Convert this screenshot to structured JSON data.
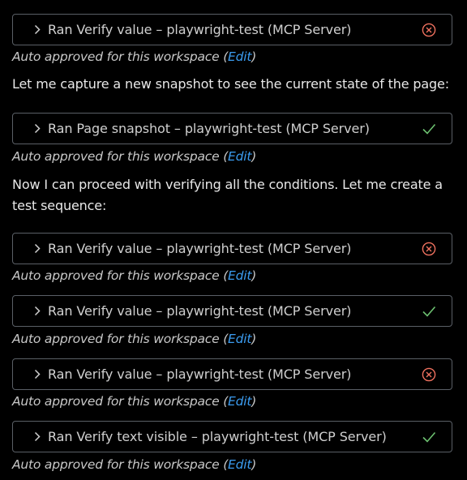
{
  "colors": {
    "background": "#000000",
    "card_border": "#5a5f66",
    "error": "#f0715f",
    "success": "#6cc070",
    "link": "#3b9cf0"
  },
  "items": [
    {
      "type": "tool",
      "ran_prefix": "Ran",
      "tool_name": "Verify value",
      "dash": "–",
      "server": "playwright-test (MCP Server)",
      "status": "error",
      "status_icon": "error-circle-x-icon",
      "approval_text": "Auto approved for this workspace",
      "approval_open": "(",
      "edit_label": "Edit",
      "approval_close": ")"
    },
    {
      "type": "message",
      "text": "Let me capture a new snapshot to see the current state of the page:"
    },
    {
      "type": "tool",
      "ran_prefix": "Ran",
      "tool_name": "Page snapshot",
      "dash": "–",
      "server": "playwright-test (MCP Server)",
      "status": "success",
      "status_icon": "checkmark-icon",
      "approval_text": "Auto approved for this workspace",
      "approval_open": "(",
      "edit_label": "Edit",
      "approval_close": ")"
    },
    {
      "type": "message",
      "text": "Now I can proceed with verifying all the conditions. Let me create a test sequence:"
    },
    {
      "type": "tool",
      "ran_prefix": "Ran",
      "tool_name": "Verify value",
      "dash": "–",
      "server": "playwright-test (MCP Server)",
      "status": "error",
      "status_icon": "error-circle-x-icon",
      "approval_text": "Auto approved for this workspace",
      "approval_open": "(",
      "edit_label": "Edit",
      "approval_close": ")"
    },
    {
      "type": "tool",
      "ran_prefix": "Ran",
      "tool_name": "Verify value",
      "dash": "–",
      "server": "playwright-test (MCP Server)",
      "status": "success",
      "status_icon": "checkmark-icon",
      "approval_text": "Auto approved for this workspace",
      "approval_open": "(",
      "edit_label": "Edit",
      "approval_close": ")"
    },
    {
      "type": "tool",
      "ran_prefix": "Ran",
      "tool_name": "Verify value",
      "dash": "–",
      "server": "playwright-test (MCP Server)",
      "status": "error",
      "status_icon": "error-circle-x-icon",
      "approval_text": "Auto approved for this workspace",
      "approval_open": "(",
      "edit_label": "Edit",
      "approval_close": ")"
    },
    {
      "type": "tool",
      "ran_prefix": "Ran",
      "tool_name": "Verify text visible",
      "dash": "–",
      "server": "playwright-test (MCP Server)",
      "status": "success",
      "status_icon": "checkmark-icon",
      "approval_text": "Auto approved for this workspace",
      "approval_open": "(",
      "edit_label": "Edit",
      "approval_close": ")"
    }
  ]
}
